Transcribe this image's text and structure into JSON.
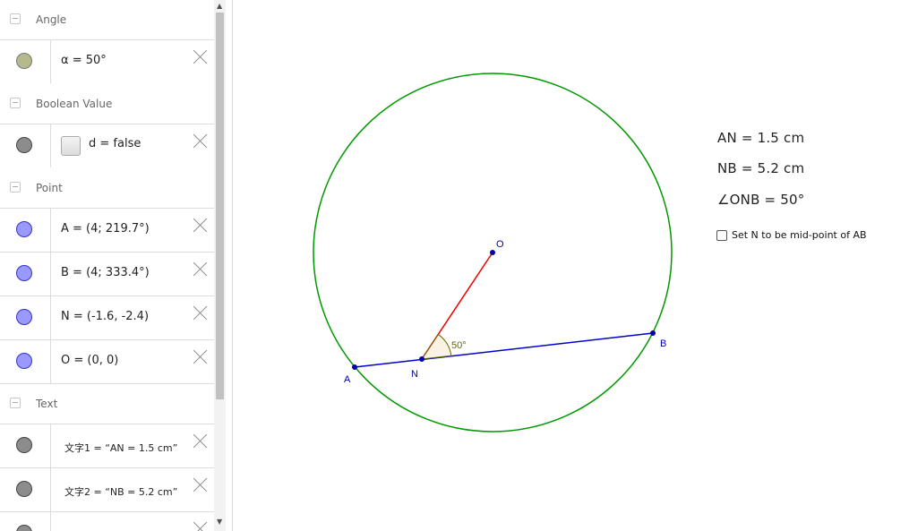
{
  "algebra": {
    "groups": {
      "angle": "Angle",
      "boolean": "Boolean Value",
      "point": "Point",
      "text": "Text"
    },
    "rows": {
      "alpha": "α = 50°",
      "d": "d = false",
      "A": "A = (4; 219.7°)",
      "B": "B = (4; 333.4°)",
      "N": "N = (-1.6, -2.4)",
      "O": "O = (0, 0)",
      "text1": "文字1 = “AN = 1.5 cm”",
      "text2": "文字2 = “NB = 5.2 cm”"
    },
    "colors": {
      "angle_dot": "#b6b98c",
      "bool_dot": "#8c8c8c",
      "point_dot": "#9999ff",
      "text_dot": "#8c8c8c"
    }
  },
  "graphics": {
    "points": {
      "O": "O",
      "A": "A",
      "B": "B",
      "N": "N"
    },
    "angle_label": "50°",
    "texts": {
      "AN": "AN  =  1.5 cm",
      "NB": "NB  =  5.2 cm",
      "ONB": "∠ONB  =  50°"
    },
    "checkbox_label": "Set N to be mid-point of AB",
    "colors": {
      "circle": "#009900",
      "segment_AB": "#0000cc",
      "segment_NO": "#ee0000",
      "point": "#0000aa",
      "angle_label": "#666600"
    }
  }
}
